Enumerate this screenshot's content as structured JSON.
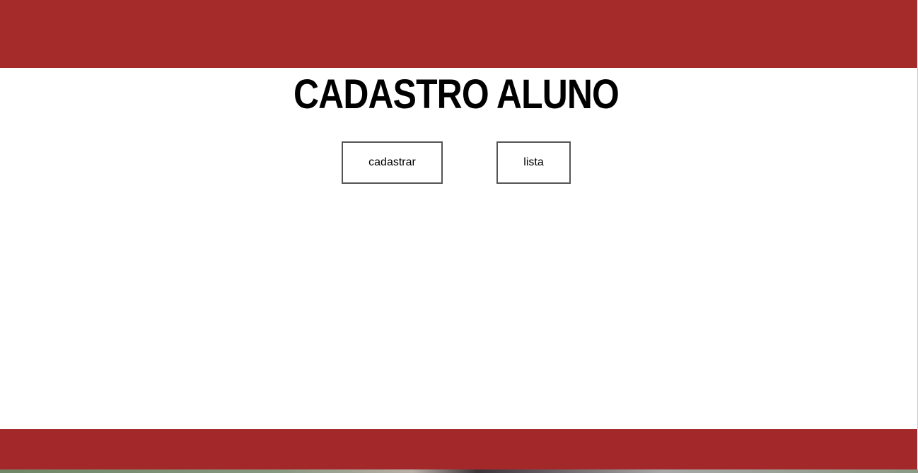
{
  "header": {
    "color": "#a52a2a"
  },
  "main": {
    "title": "CADASTRO ALUNO",
    "buttons": {
      "cadastrar_label": "cadastrar",
      "lista_label": "lista"
    }
  },
  "footer": {
    "color": "#a2282a"
  }
}
